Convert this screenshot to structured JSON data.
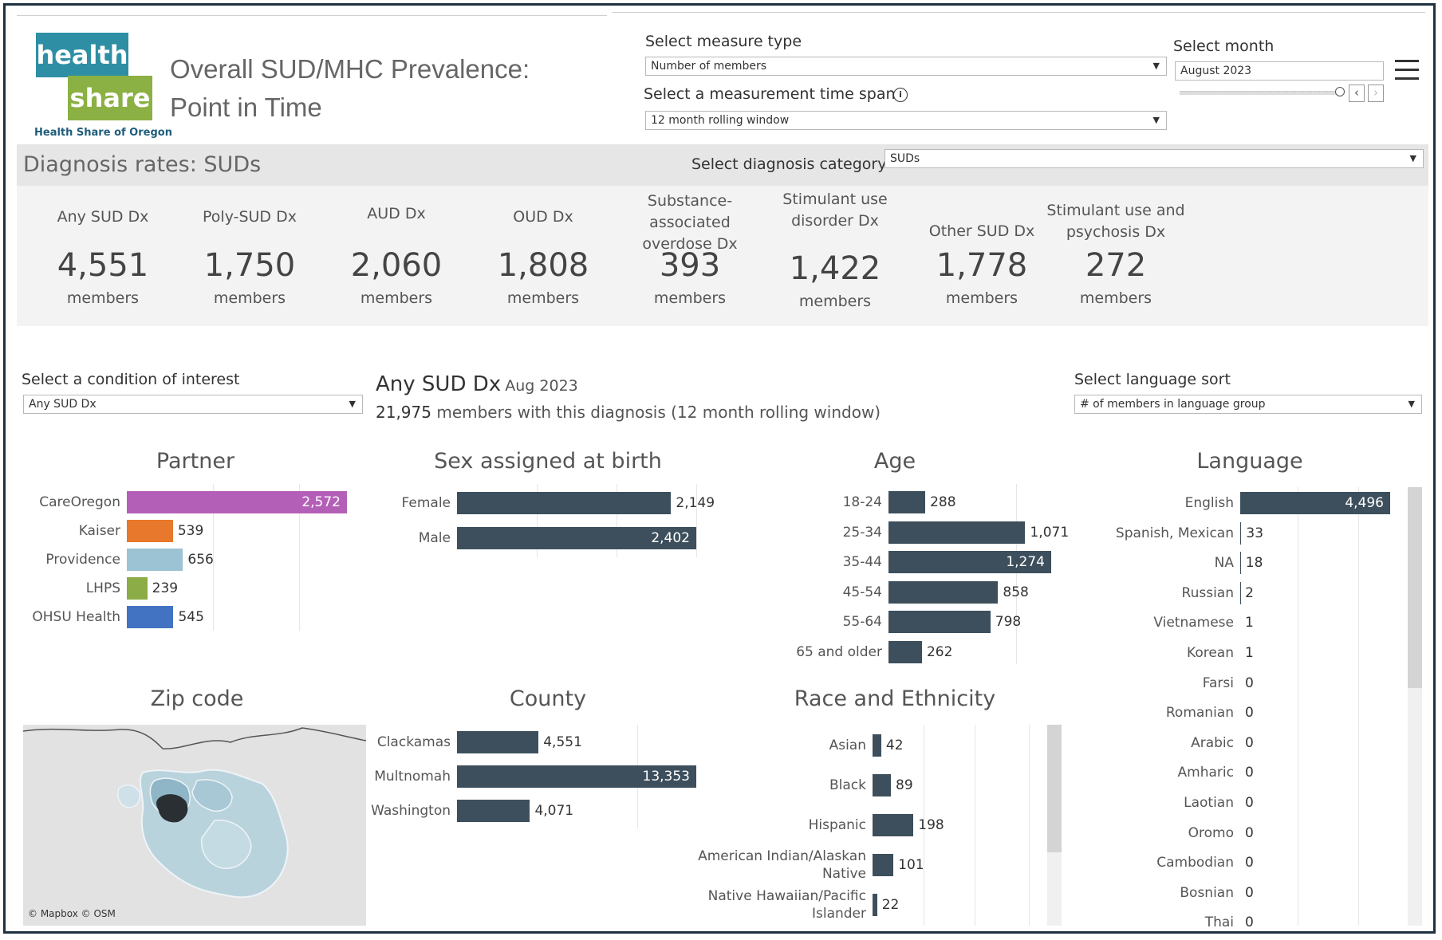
{
  "logo": {
    "line1": "health",
    "line2": "share",
    "org": "Health Share of Oregon"
  },
  "title": {
    "line1": "Overall SUD/MHC Prevalence:",
    "line2": "Point in Time"
  },
  "controls": {
    "measure_type": {
      "label": "Select measure type",
      "value": "Number of members"
    },
    "time_span": {
      "label": "Select a measurement time span",
      "value": "12 month rolling window"
    },
    "month": {
      "label": "Select month",
      "value": "August 2023",
      "slider_position": 0.98
    },
    "diagnosis_category": {
      "label": "Select diagnosis category",
      "value": "SUDs"
    },
    "condition": {
      "label": "Select a condition of interest",
      "value": "Any SUD Dx"
    },
    "language_sort": {
      "label": "Select language sort",
      "value": "# of members in language group"
    }
  },
  "icons": {
    "info": "info-icon",
    "menu": "hamburger-menu-icon",
    "prev": "chevron-left-icon",
    "next": "chevron-right-icon",
    "caret": "chevron-down-icon"
  },
  "banner": {
    "title": "Diagnosis rates: SUDs"
  },
  "kpis": [
    {
      "name": "Any SUD Dx",
      "value": "4,551",
      "unit": "members"
    },
    {
      "name": "Poly-SUD Dx",
      "value": "1,750",
      "unit": "members"
    },
    {
      "name": "AUD Dx",
      "value": "2,060",
      "unit": "members"
    },
    {
      "name": "OUD Dx",
      "value": "1,808",
      "unit": "members"
    },
    {
      "name": "Substance-associated overdose Dx",
      "value": "393",
      "unit": "members"
    },
    {
      "name": "Stimulant use disorder Dx",
      "value": "1,422",
      "unit": "members"
    },
    {
      "name": "Other SUD Dx",
      "value": "1,778",
      "unit": "members"
    },
    {
      "name": "Stimulant use and psychosis Dx",
      "value": "272",
      "unit": "members"
    }
  ],
  "summary": {
    "condition": "Any SUD Dx",
    "month": "Aug 2023",
    "count": "21,975",
    "text": "members with this diagnosis (12 month rolling window)"
  },
  "colors": {
    "bar": "#3d4f5c",
    "careoregon": "#b45fb7",
    "kaiser": "#e8782b",
    "providence": "#9cc3d3",
    "lhps": "#8cac47",
    "ohsu": "#4273c2"
  },
  "chart_data": [
    {
      "type": "bar",
      "title": "Partner",
      "categories": [
        "CareOregon",
        "Kaiser",
        "Providence",
        "LHPS",
        "OHSU Health"
      ],
      "values": [
        2572,
        539,
        656,
        239,
        545
      ],
      "labels": [
        "2,572",
        "539",
        "656",
        "239",
        "545"
      ]
    },
    {
      "type": "bar",
      "title": "Sex assigned at birth",
      "categories": [
        "Female",
        "Male"
      ],
      "values": [
        2149,
        2402
      ],
      "labels": [
        "2,149",
        "2,402"
      ]
    },
    {
      "type": "bar",
      "title": "Age",
      "categories": [
        "18-24",
        "25-34",
        "35-44",
        "45-54",
        "55-64",
        "65 and older"
      ],
      "values": [
        288,
        1071,
        1274,
        858,
        798,
        262
      ],
      "labels": [
        "288",
        "1,071",
        "1,274",
        "858",
        "798",
        "262"
      ]
    },
    {
      "type": "bar",
      "title": "Language",
      "categories": [
        "English",
        "Spanish, Mexican",
        "NA",
        "Russian",
        "Vietnamese",
        "Korean",
        "Farsi",
        "Romanian",
        "Arabic",
        "Amharic",
        "Laotian",
        "Oromo",
        "Cambodian",
        "Bosnian",
        "Thai"
      ],
      "values": [
        4496,
        33,
        18,
        2,
        1,
        1,
        0,
        0,
        0,
        0,
        0,
        0,
        0,
        0,
        0
      ],
      "labels": [
        "4,496",
        "33",
        "18",
        "2",
        "1",
        "1",
        "0",
        "0",
        "0",
        "0",
        "0",
        "0",
        "0",
        "0",
        "0"
      ]
    },
    {
      "type": "bar",
      "title": "County",
      "categories": [
        "Clackamas",
        "Multnomah",
        "Washington"
      ],
      "values": [
        4551,
        13353,
        4071
      ],
      "labels": [
        "4,551",
        "13,353",
        "4,071"
      ]
    },
    {
      "type": "bar",
      "title": "Race and Ethnicity",
      "categories": [
        "Asian",
        "Black",
        "Hispanic",
        "American Indian/Alaskan Native",
        "Native Hawaiian/Pacific Islander"
      ],
      "values": [
        42,
        89,
        198,
        101,
        22
      ],
      "labels": [
        "42",
        "89",
        "198",
        "101",
        "22"
      ]
    }
  ],
  "map": {
    "title": "Zip code",
    "attribution": "© Mapbox © OSM"
  }
}
